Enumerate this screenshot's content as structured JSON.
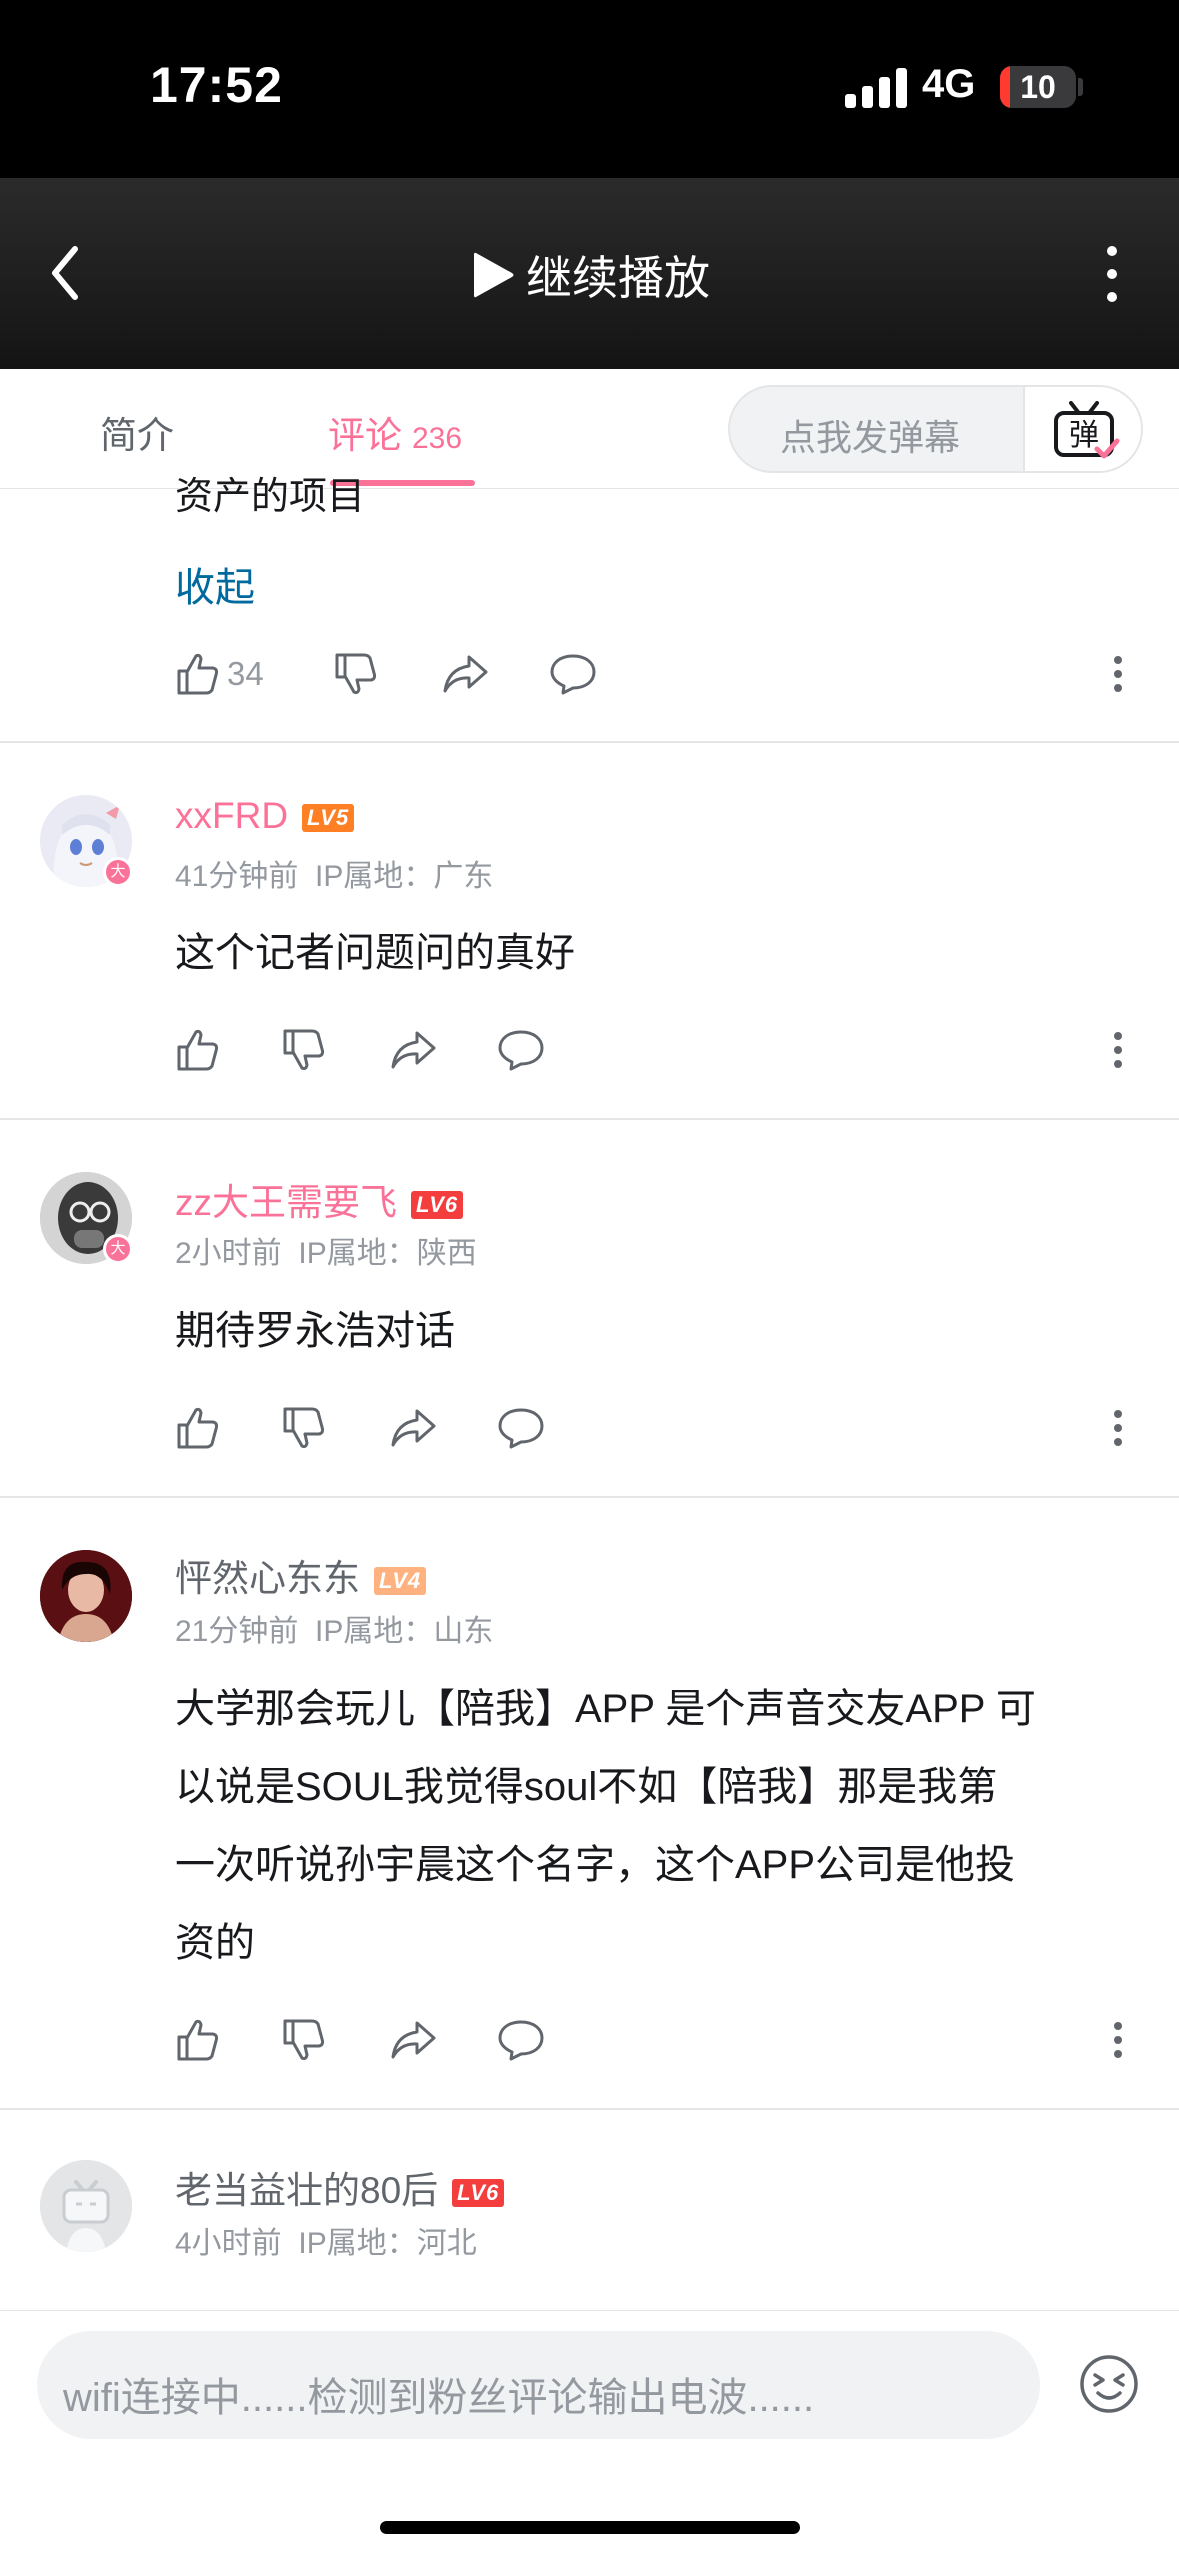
{
  "status_bar": {
    "time": "17:52",
    "network": "4G",
    "battery": "10"
  },
  "top_bar": {
    "play_label": "继续播放"
  },
  "tabs": {
    "intro": "简介",
    "comments": "评论",
    "comments_count": "236",
    "danmaku_placeholder": "点我发弹幕",
    "danmaku_icon_text": "弹"
  },
  "prev_comment": {
    "cut_text": "资产的项目",
    "collapse": "收起",
    "likes": "34"
  },
  "comments": [
    {
      "username": "xxFRD",
      "level": "LV5",
      "time": "41分钟前",
      "ip": "IP属地：广东",
      "text": "这个记者问题问的真好"
    },
    {
      "username": "zz大王需要飞",
      "level": "LV6",
      "time": "2小时前",
      "ip": "IP属地：陕西",
      "text": "期待罗永浩对话"
    },
    {
      "username": "怦然心东东",
      "level": "LV4",
      "time": "21分钟前",
      "ip": "IP属地：山东",
      "lines": [
        "大学那会玩儿【陪我】APP 是个声音交友APP 可",
        "以说是SOUL我觉得soul不如【陪我】那是我第",
        "一次听说孙宇晨这个名字，这个APP公司是他投",
        "资的"
      ]
    },
    {
      "username": "老当益壮的80后",
      "level": "LV6",
      "time": "4小时前",
      "ip": "IP属地：河北"
    }
  ],
  "badge_text": "大",
  "bottom": {
    "input_placeholder": "wifi连接中......检测到粉丝评论输出电波......"
  },
  "colors": {
    "accent": "#fb7299",
    "link": "#00699d",
    "lv4": "#ffb27f",
    "lv5": "#ff7f24",
    "lv6": "#f43e3e"
  }
}
